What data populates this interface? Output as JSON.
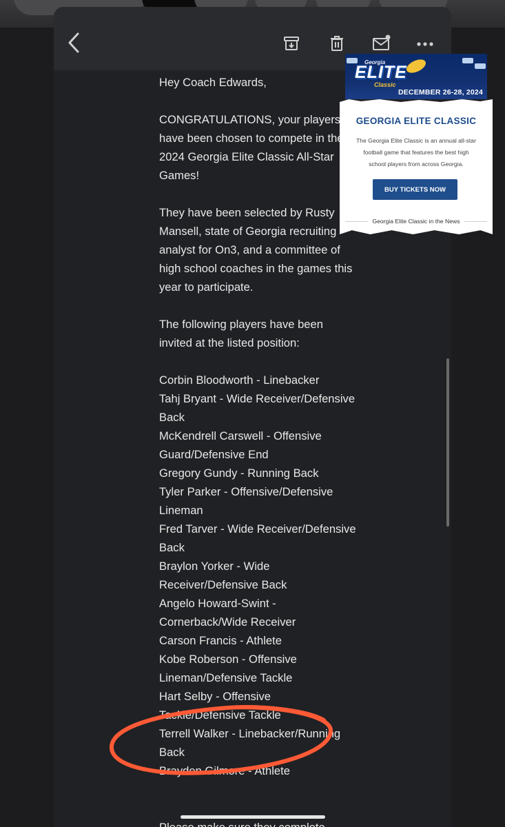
{
  "email": {
    "greeting": "Hey Coach Edwards,",
    "para1": "CONGRATULATIONS, your players have been chosen to compete in the 2024 Georgia Elite Classic All-Star Games!",
    "para2": "They have been selected by Rusty Mansell, state of Georgia recruiting analyst for On3, and a committee of high school coaches in the games this year to participate.",
    "para3": "The following players have been invited at the listed position:",
    "players": [
      "Corbin Bloodworth - Linebacker",
      "Tahj Bryant - Wide Receiver/Defensive Back",
      "McKendrell Carswell - Offensive Guard/Defensive End",
      "Gregory Gundy - Running Back",
      "Tyler Parker - Offensive/Defensive Lineman",
      "Fred Tarver - Wide Receiver/Defensive Back",
      "Braylon Yorker - Wide Receiver/Defensive Back",
      "Angelo Howard-Swint - Cornerback/Wide Receiver",
      "Carson Francis - Athlete",
      "Kobe Roberson - Offensive Lineman/Defensive Tackle",
      "Hart Selby - Offensive Tackle/Defensive Tackle",
      "Terrell Walker - Linebacker/Running Back",
      "Brayden Gilmore - Athlete"
    ],
    "closing": "Please make sure they complete"
  },
  "promo": {
    "logo_sub": "Georgia",
    "logo_main": "ELITE",
    "logo_tag": "Classic",
    "banner_date": "DECEMBER 26-28, 2024",
    "title": "GEORGIA ELITE CLASSIC",
    "description": "The Georgia Elite Classic is an annual all-star football game that features the best high school players from across Georgia.",
    "button": "BUY TICKETS NOW",
    "news": "Georgia Elite Classic in the News"
  },
  "icons": {
    "back": "back-arrow-icon",
    "archive": "archive-icon",
    "delete": "trash-icon",
    "unread": "mail-unread-icon",
    "more": "more-dots-icon"
  },
  "colors": {
    "annotation": "#ff5a36",
    "brand": "#1f4e8c"
  }
}
